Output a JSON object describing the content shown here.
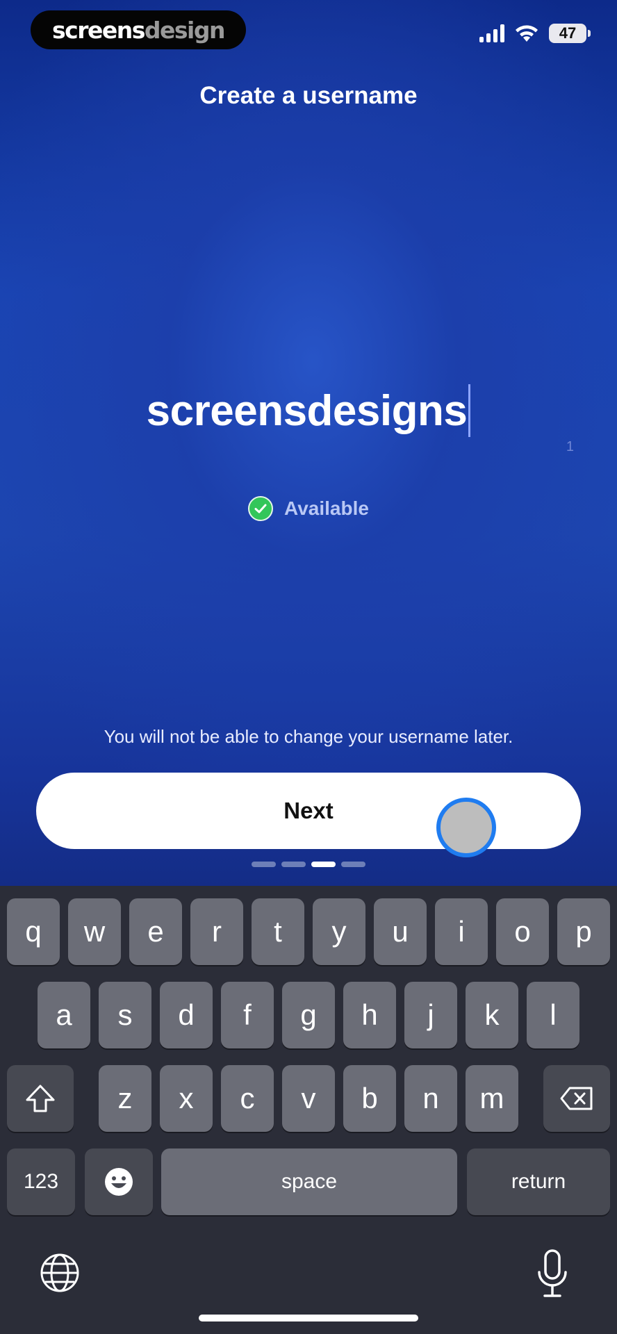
{
  "status_bar": {
    "brand_primary": "screens",
    "brand_secondary": "design",
    "battery": "47"
  },
  "screen": {
    "title": "Create a username",
    "username_value": "screensdesigns",
    "char_count": "1",
    "availability": "Available",
    "notice": "You will not be able to change your username later.",
    "next_label": "Next",
    "page_indicator": {
      "count": 4,
      "active_index": 2
    }
  },
  "keyboard": {
    "row1": [
      "q",
      "w",
      "e",
      "r",
      "t",
      "y",
      "u",
      "i",
      "o",
      "p"
    ],
    "row2": [
      "a",
      "s",
      "d",
      "f",
      "g",
      "h",
      "j",
      "k",
      "l"
    ],
    "row3": [
      "z",
      "x",
      "c",
      "v",
      "b",
      "n",
      "m"
    ],
    "numbers_label": "123",
    "space_label": "space",
    "return_label": "return"
  },
  "colors": {
    "accent_touch": "#1f7cf0",
    "available_check": "#33c65a",
    "keyboard_bg": "#2b2d38"
  }
}
